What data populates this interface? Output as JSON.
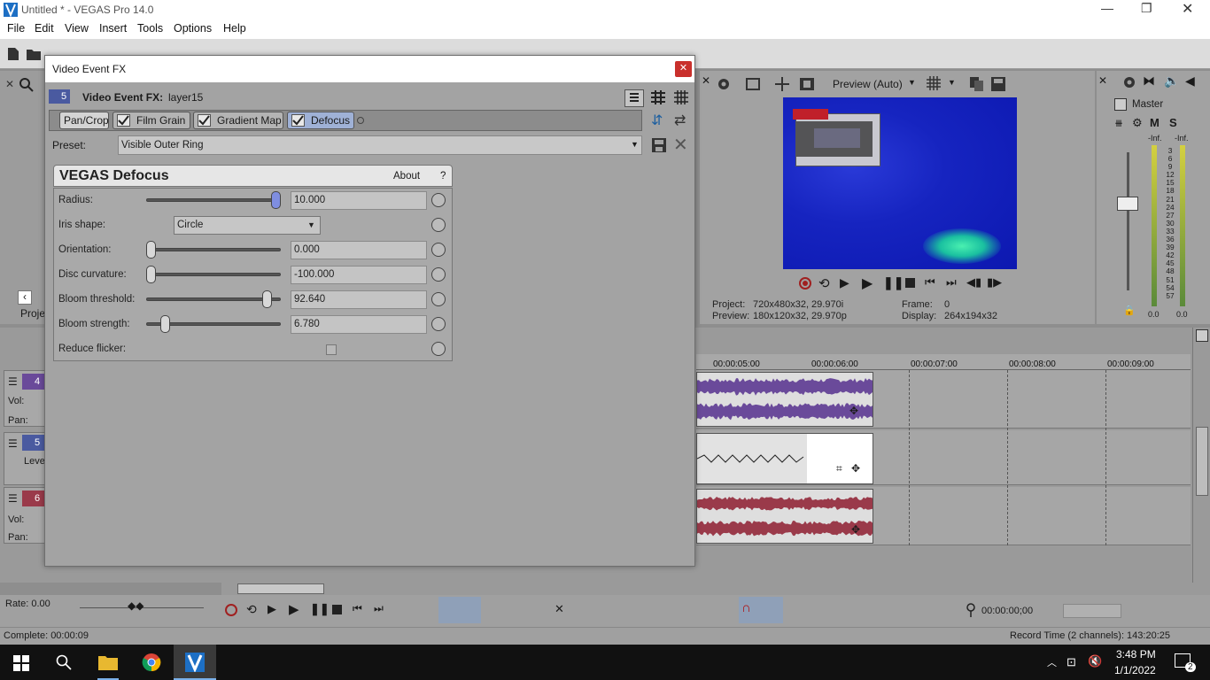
{
  "window": {
    "title": "Untitled * - VEGAS Pro 14.0"
  },
  "menu": [
    "File",
    "Edit",
    "View",
    "Insert",
    "Tools",
    "Options",
    "Help"
  ],
  "dialog": {
    "title": "Video Event FX",
    "track_num": "5",
    "fx_label": "Video Event FX:",
    "fx_target": "layer15",
    "tabs": [
      "Pan/Crop",
      "Film Grain",
      "Gradient Map",
      "Defocus"
    ],
    "preset_label": "Preset:",
    "preset_value": "Visible Outer Ring",
    "plugin_title": "VEGAS Defocus",
    "about": "About",
    "help": "?",
    "params": [
      {
        "label": "Radius:",
        "value": "10.000",
        "level": 1.0
      },
      {
        "label": "Iris shape:",
        "value": "Circle"
      },
      {
        "label": "Orientation:",
        "value": "0.000",
        "level": 0.0
      },
      {
        "label": "Disc curvature:",
        "value": "-100.000",
        "level": 0.0
      },
      {
        "label": "Bloom threshold:",
        "value": "92.640",
        "level": 0.93
      },
      {
        "label": "Bloom strength:",
        "value": "6.780",
        "level": 0.11
      },
      {
        "label": "Reduce flicker:",
        "value": ""
      }
    ]
  },
  "preview": {
    "mode": "Preview (Auto)",
    "project_label": "Project:",
    "project_value": "720x480x32, 29.970i",
    "preview_label": "Preview:",
    "preview_value": "180x120x32, 29.970p",
    "frame_label": "Frame:",
    "frame_value": "0",
    "display_label": "Display:",
    "display_value": "264x194x32"
  },
  "master": {
    "label": "Master",
    "m": "M",
    "s": "S",
    "inf_left": "-Inf.",
    "inf_right": "-Inf.",
    "scale": [
      "3",
      "6",
      "9",
      "12",
      "15",
      "18",
      "21",
      "24",
      "27",
      "30",
      "33",
      "36",
      "39",
      "42",
      "45",
      "48",
      "51",
      "54",
      "57"
    ],
    "bottom_left": "0.0",
    "bottom_right": "0.0"
  },
  "left_panel": {
    "proj": "Proje"
  },
  "tracks": [
    {
      "num": "4",
      "vol": "Vol:",
      "pan": "Pan:",
      "color": "#6a4a9a"
    },
    {
      "num": "5",
      "level": "Leve",
      "color": "#4a5aa0"
    },
    {
      "num": "6",
      "vol": "Vol:",
      "pan": "Pan:",
      "color": "#9a3a4a"
    }
  ],
  "ruler": [
    "00:00:05:00",
    "00:00:06:00",
    "00:00:07:00",
    "00:00:08:00",
    "00:00:09:00"
  ],
  "status": {
    "rate": "Rate: 0.00",
    "complete": "Complete: 00:00:09",
    "record_time": "Record Time (2 channels): 143:20:25",
    "timecode": "00:00:00;00"
  },
  "taskbar": {
    "time": "3:48 PM",
    "date": "1/1/2022",
    "notif": "2"
  }
}
